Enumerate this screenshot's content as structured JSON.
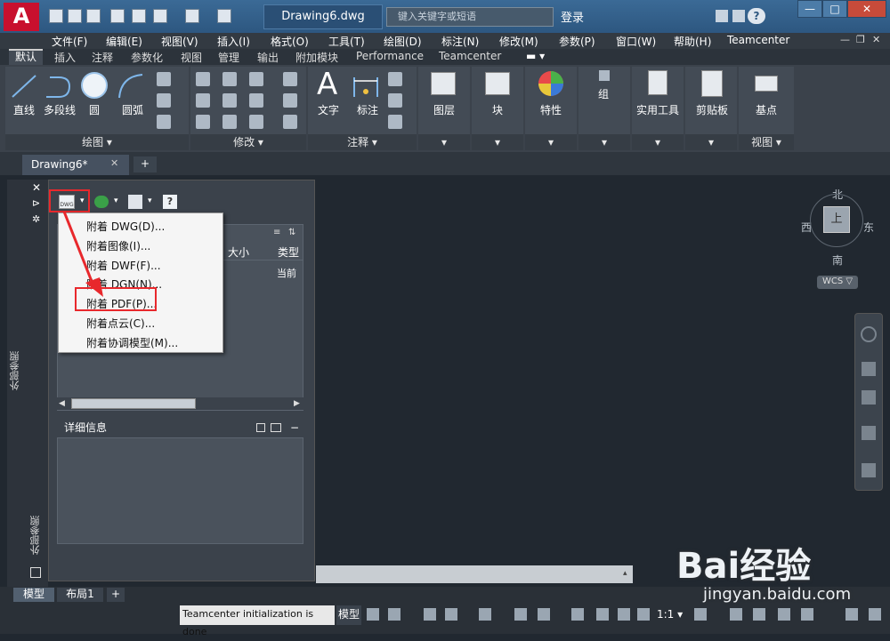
{
  "titlebar": {
    "logo": "A",
    "document_title": "Drawing6.dwg",
    "search_placeholder": "键入关键字或短语",
    "login": "登录",
    "help": "?",
    "minimize": "—",
    "maximize": "□",
    "close": "✕"
  },
  "menubar": {
    "items": [
      "文件(F)",
      "编辑(E)",
      "视图(V)",
      "插入(I)",
      "格式(O)",
      "工具(T)",
      "绘图(D)",
      "标注(N)",
      "修改(M)",
      "参数(P)",
      "窗口(W)",
      "帮助(H)",
      "Teamcenter"
    ]
  },
  "ribbon_tabs": {
    "items": [
      "默认",
      "插入",
      "注释",
      "参数化",
      "视图",
      "管理",
      "输出",
      "附加模块",
      "Performance",
      "Teamcenter"
    ]
  },
  "ribbon": {
    "draw": {
      "line": "直线",
      "polyline": "多段线",
      "circle": "圆",
      "arc": "圆弧",
      "title": "绘图 ▾"
    },
    "modify": {
      "title": "修改 ▾"
    },
    "annotation": {
      "text": "文字",
      "dimension": "标注",
      "title": "注释 ▾"
    },
    "layers": "图层",
    "block": "块",
    "properties": "特性",
    "group": "组",
    "utilities": "实用工具",
    "clipboard": "剪贴板",
    "base": "基点",
    "view_title": "视图 ▾"
  },
  "doc_tabs": {
    "tab": "Drawing6*",
    "close": "✕",
    "new": "+"
  },
  "xref": {
    "side_title": "外部参照",
    "list_header_size": "大小",
    "list_header_type": "类型",
    "list_row_type": "当前",
    "detail_title": "详细信息"
  },
  "dropdown": {
    "items": [
      "附着 DWG(D)...",
      "附着图像(I)...",
      "附着 DWF(F)...",
      "附着 DGN(N)...",
      "附着 PDF(P)...",
      "附着点云(C)...",
      "附着协调模型(M)..."
    ]
  },
  "viewport": {
    "viewcube_face": "上",
    "north": "北",
    "south": "南",
    "east": "东",
    "west": "西",
    "wcs": "WCS ▽"
  },
  "layout_tabs": {
    "model": "模型",
    "layout1": "布局1",
    "add": "+"
  },
  "statusbar": {
    "message": "Teamcenter initialization is done",
    "space": "模型",
    "scale": "1:1 ▾"
  },
  "watermark": {
    "brand": "Bai经验",
    "url": "jingyan.baidu.com"
  }
}
